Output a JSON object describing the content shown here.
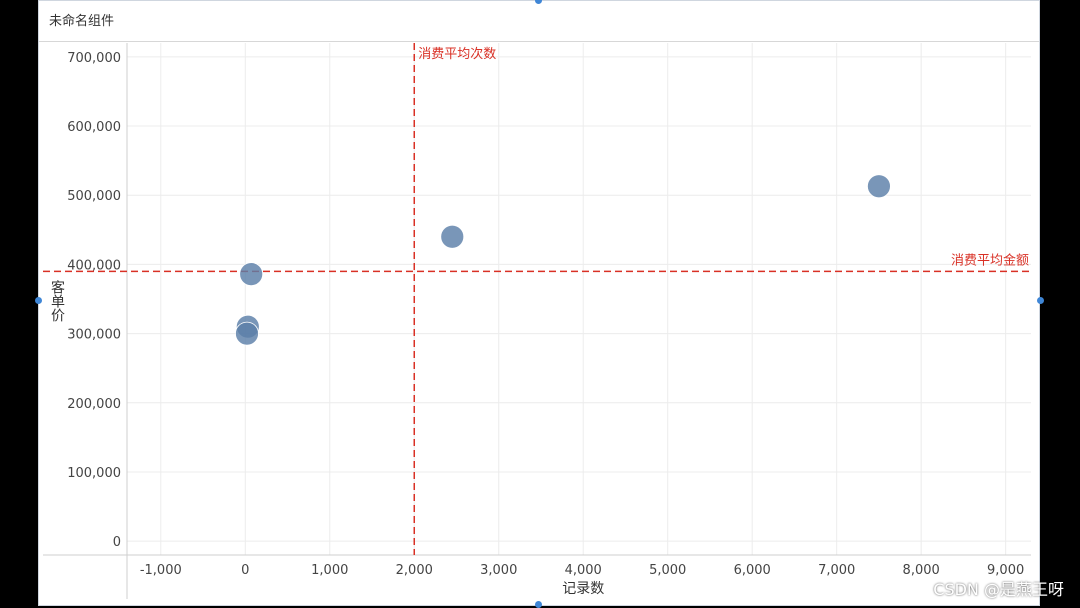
{
  "panel": {
    "title": "未命名组件"
  },
  "watermark": "CSDN @是燕王呀",
  "chart_data": {
    "type": "scatter",
    "xlabel": "记录数",
    "ylabel": "客单价",
    "xlim": [
      -1400,
      9300
    ],
    "ylim": [
      -20000,
      720000
    ],
    "x_ticks": [
      -1000,
      0,
      1000,
      2000,
      3000,
      4000,
      5000,
      6000,
      7000,
      8000,
      9000
    ],
    "y_ticks": [
      0,
      100000,
      200000,
      300000,
      400000,
      500000,
      600000,
      700000
    ],
    "x_tick_labels": [
      "-1,000",
      "0",
      "1,000",
      "2,000",
      "3,000",
      "4,000",
      "5,000",
      "6,000",
      "7,000",
      "8,000",
      "9,000"
    ],
    "y_tick_labels": [
      "0",
      "100,000",
      "200,000",
      "300,000",
      "400,000",
      "500,000",
      "600,000",
      "700,000"
    ],
    "grid": true,
    "points": [
      {
        "x": 70,
        "y": 386000
      },
      {
        "x": 30,
        "y": 310000
      },
      {
        "x": 20,
        "y": 300000
      },
      {
        "x": 2450,
        "y": 440000
      },
      {
        "x": 7500,
        "y": 513000
      }
    ],
    "reference_lines": [
      {
        "axis": "x",
        "value": 2000,
        "label": "消费平均次数"
      },
      {
        "axis": "y",
        "value": 390000,
        "label": "消费平均金额"
      }
    ],
    "colors": {
      "point": "#5b7fa8",
      "reference": "#d93025",
      "grid": "#ececec",
      "axis": "#cfcfcf",
      "tick_text": "#444444"
    }
  }
}
